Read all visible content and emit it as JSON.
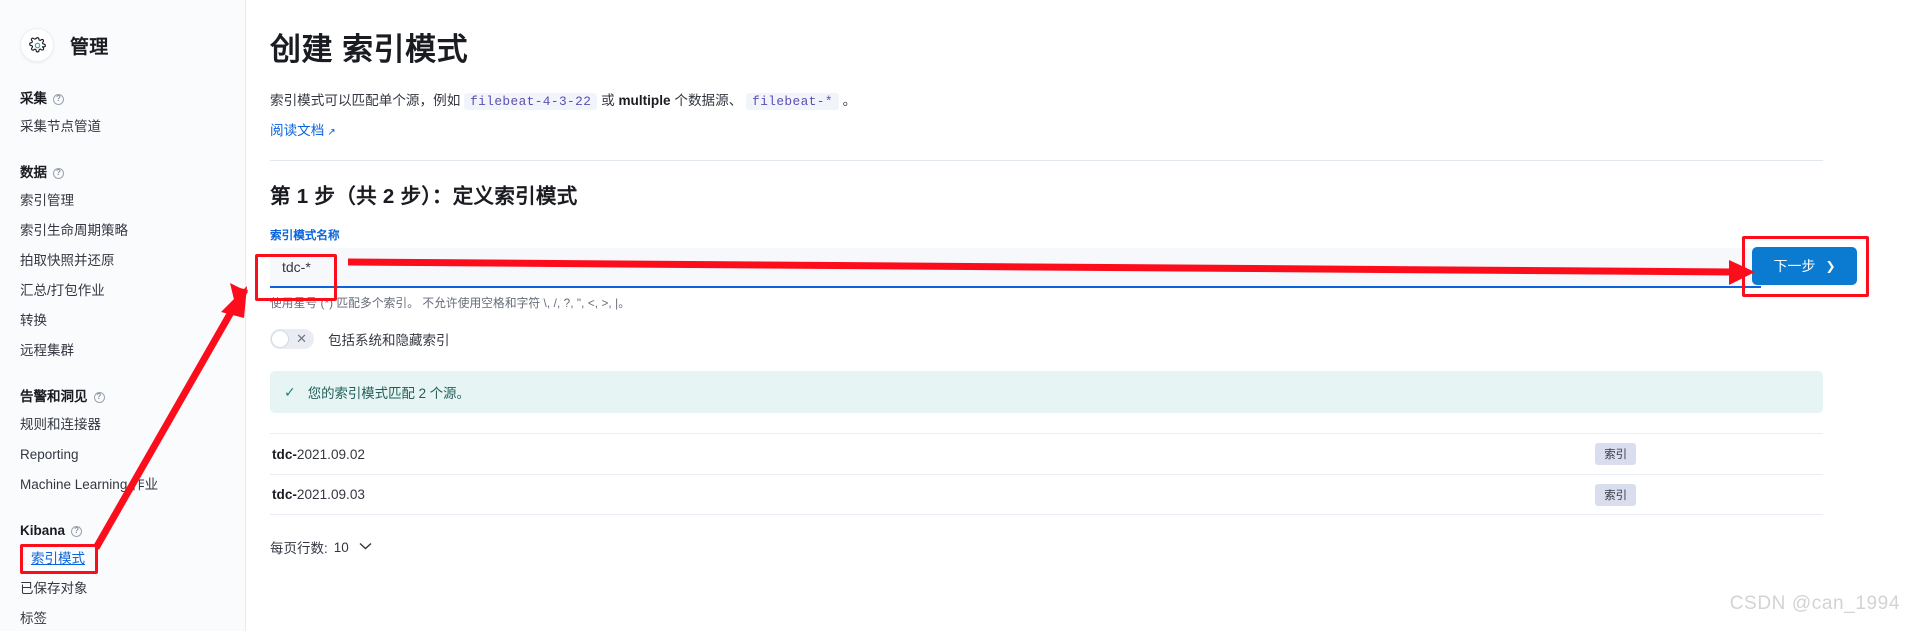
{
  "sidebar": {
    "header": {
      "icon": "gear-icon",
      "title": "管理"
    },
    "groups": [
      {
        "label": "采集",
        "has_help_icon": true,
        "items": [
          {
            "label": "采集节点管道",
            "state": "default"
          }
        ]
      },
      {
        "label": "数据",
        "has_help_icon": true,
        "items": [
          {
            "label": "索引管理",
            "state": "default"
          },
          {
            "label": "索引生命周期策略",
            "state": "default"
          },
          {
            "label": "拍取快照并还原",
            "state": "default"
          },
          {
            "label": "汇总/打包作业",
            "state": "default"
          },
          {
            "label": "转换",
            "state": "default"
          },
          {
            "label": "远程集群",
            "state": "default"
          }
        ]
      },
      {
        "label": "告警和洞见",
        "has_help_icon": true,
        "items": [
          {
            "label": "规则和连接器",
            "state": "default"
          },
          {
            "label": "Reporting",
            "state": "default"
          },
          {
            "label": "Machine Learning 作业",
            "state": "default"
          }
        ]
      },
      {
        "label": "Kibana",
        "has_help_icon": true,
        "items": [
          {
            "label": "索引模式",
            "state": "active-boxed"
          },
          {
            "label": "已保存对象",
            "state": "default"
          },
          {
            "label": "标签",
            "state": "default"
          }
        ]
      }
    ]
  },
  "main": {
    "page_title": "创建 索引模式",
    "description": {
      "part1": "索引模式可以匹配单个源，例如 ",
      "code1": "filebeat-4-3-22",
      "part2": " 或 ",
      "bold1": "multiple",
      "part3": " 个数据源、 ",
      "code2": "filebeat-*",
      "part4": " 。"
    },
    "doc_link": {
      "label": "阅读文档",
      "icon": "external-link-icon"
    },
    "step_title": "第 1 步（共 2 步）：定义索引模式",
    "field": {
      "label": "索引模式名称",
      "value": "tdc-*",
      "placeholder": "",
      "help_text": "使用星号 (*) 匹配多个索引。 不允许使用空格和字符 \\, /, ?, \", <, >, |。"
    },
    "toggle": {
      "label": "包括系统和隐藏索引",
      "checked": false,
      "off_glyph": "✕"
    },
    "callout": {
      "icon": "check-icon",
      "text": "您的索引模式匹配 2 个源。"
    },
    "table": {
      "rows": [
        {
          "prefix": "tdc-",
          "suffix": "2021.09.02",
          "badge": "索引"
        },
        {
          "prefix": "tdc-",
          "suffix": "2021.09.03",
          "badge": "索引"
        }
      ]
    },
    "pager": {
      "label": "每页行数:",
      "value": "10",
      "chevron": "⌄"
    },
    "next_button": {
      "label": "下一步",
      "chevron": "❯"
    }
  },
  "watermark": "CSDN @can_1994",
  "colors": {
    "accent_blue": "#0b64dd",
    "button_blue": "#0b7ad1",
    "annotation_red": "#fc0d1c",
    "callout_bg": "#e6f5f3",
    "badge_bg": "#d9dded",
    "sidebar_bg": "#fafbfd"
  }
}
